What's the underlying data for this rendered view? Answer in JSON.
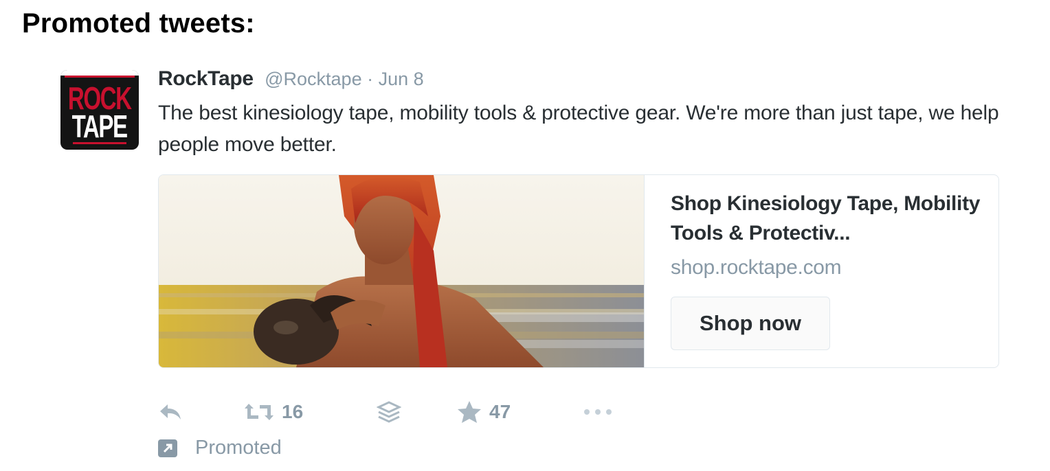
{
  "page": {
    "heading": "Promoted tweets:"
  },
  "tweet": {
    "avatar": {
      "logo_line1": "ROCK",
      "logo_line2": "TAPE"
    },
    "author_name": "RockTape",
    "author_handle": "@Rocktape",
    "separator": "·",
    "date": "Jun 8",
    "text": "The best kinesiology tape, mobility tools & protective gear. We're more than just tape, we help people move better.",
    "card": {
      "title": "Shop Kinesiology Tape, Mobility Tools & Protectiv...",
      "url": "shop.rocktape.com",
      "button_label": "Shop now"
    },
    "actions": {
      "retweet_count": "16",
      "favorite_count": "47"
    },
    "promoted_label": "Promoted"
  },
  "colors": {
    "brand_red": "#c8102e",
    "text_dark": "#292f33",
    "text_muted": "#8899a6",
    "icon_muted": "#aab8c2",
    "border": "#e1e8ed"
  },
  "icons": [
    "reply-icon",
    "retweet-icon",
    "buffer-icon",
    "favorite-icon",
    "more-icon",
    "promoted-icon"
  ]
}
